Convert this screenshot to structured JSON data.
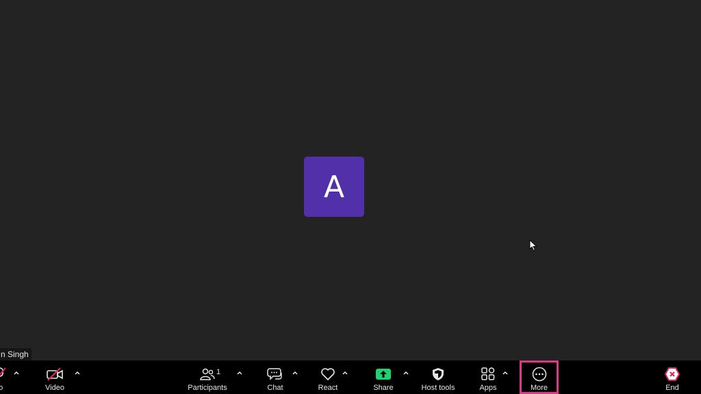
{
  "participant": {
    "initial": "A",
    "name_tag": "n Singh",
    "avatar_color": "#5230a9"
  },
  "toolbar": {
    "audio_label": "io",
    "video_label": "Video",
    "participants_label": "Participants",
    "participants_count": "1",
    "chat_label": "Chat",
    "react_label": "React",
    "share_label": "Share",
    "host_tools_label": "Host tools",
    "apps_label": "Apps",
    "more_label": "More",
    "end_label": "End"
  },
  "colors": {
    "share_accent": "#19d470",
    "muted_red": "#e0245e",
    "highlight": "#e0368a",
    "end_red": "#e0245e"
  },
  "icons": {
    "audio": "microphone-muted-icon",
    "video": "video-camera-off-icon",
    "participants": "people-icon",
    "chat": "chat-bubbles-icon",
    "react": "heart-icon",
    "share": "share-screen-icon",
    "host_tools": "shield-icon",
    "apps": "apps-grid-icon",
    "more": "more-ellipsis-icon",
    "end": "end-meeting-icon",
    "cursor": "mouse-pointer-icon"
  }
}
